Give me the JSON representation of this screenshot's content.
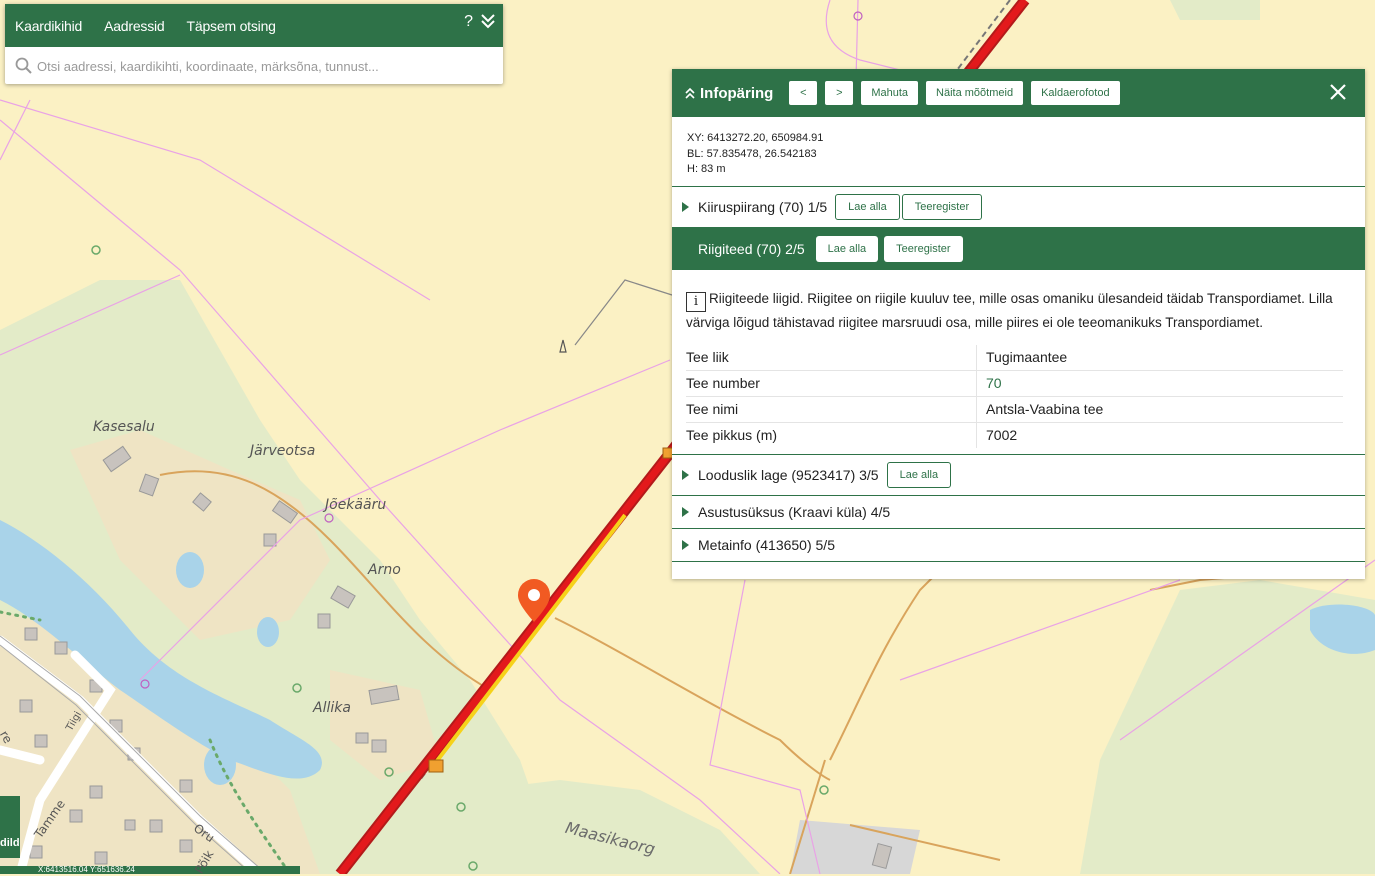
{
  "search": {
    "tabs": [
      "Kaardikihid",
      "Aadressid",
      "Täpsem otsing"
    ],
    "help_glyph": "?",
    "collapse_glyph": "⌄⌄",
    "placeholder": "Otsi aadressi, kaardikihti, koordinaate, märksõna, tunnust..."
  },
  "info": {
    "title": "Infopäring",
    "prev_label": "<",
    "next_label": ">",
    "fit_label": "Mahuta",
    "measure_label": "Näita mõõtmeid",
    "oblique_label": "Kaldaerofotod",
    "coords": {
      "xy": "XY: 6413272.20, 650984.91",
      "bl": "BL: 57.835478, 26.542183",
      "h": "H: 83 m"
    },
    "sections": [
      {
        "title": "Kiiruspiirang (70) 1/5",
        "buttons": [
          "Lae alla",
          "Teeregister"
        ]
      },
      {
        "title": "Riigiteed (70) 2/5",
        "buttons": [
          "Lae alla",
          "Teeregister"
        ]
      },
      {
        "title": "Looduslik lage (9523417) 3/5",
        "buttons": [
          "Lae alla"
        ]
      },
      {
        "title": "Asustusüksus (Kraavi küla) 4/5",
        "buttons": []
      },
      {
        "title": "Metainfo (413650) 5/5",
        "buttons": []
      }
    ],
    "description": "Riigiteede liigid. Riigitee on riigile kuuluv tee, mille osas omaniku ülesandeid täidab Transpordiamet. Lilla värviga lõigud tähistavad riigitee marsruudi osa, mille piires ei ole teeomanikuks Transpordiamet.",
    "attributes": [
      {
        "key": "Tee liik",
        "value": "Tugimaantee"
      },
      {
        "key": "Tee number",
        "value": "70"
      },
      {
        "key": "Tee nimi",
        "value": "Antsla-Vaabina tee"
      },
      {
        "key": "Tee pikkus (m)",
        "value": "7002"
      }
    ]
  },
  "map": {
    "place_labels": [
      "Kasesalu",
      "Järveotsa",
      "Jõekääru",
      "Arno",
      "Allika",
      "Maasikaorg"
    ],
    "street_labels": [
      "Tamme",
      "Oru",
      "Põik",
      "Tiigi",
      "re"
    ],
    "corner_label": "dild",
    "coord_readout": "X:6413516.04 Y:651636.24",
    "colors": {
      "brand_green": "#2e7248",
      "road_red": "#e3191c",
      "marker_orange": "#f15a22",
      "water": "#a9d3e9",
      "forest": "#e3ebc8"
    }
  }
}
